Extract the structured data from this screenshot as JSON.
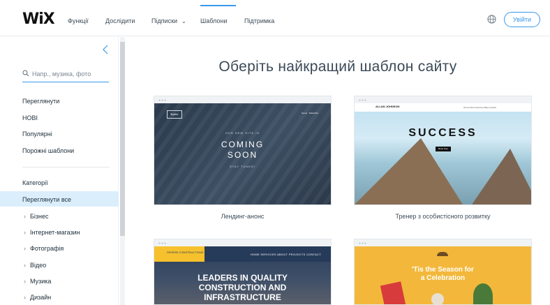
{
  "header": {
    "logo": "WiX",
    "nav": [
      {
        "label": "Функції"
      },
      {
        "label": "Дослідити"
      },
      {
        "label": "Підписки"
      },
      {
        "label": "Шаблони"
      },
      {
        "label": "Підтримка"
      }
    ],
    "active_nav": "Шаблони",
    "login_label": "Увійти"
  },
  "sidebar": {
    "search_placeholder": "Напр., музика, фото",
    "browse": [
      "Переглянути",
      "НОВІ",
      "Популярні",
      "Порожні шаблони"
    ],
    "categories_heading": "Категорії",
    "selected": "Переглянути все",
    "categories": [
      "Бізнес",
      "Інтернет-магазин",
      "Фотографія",
      "Відео",
      "Музика",
      "Дизайн"
    ]
  },
  "main": {
    "title": "Оберіть найкращий шаблон сайту",
    "cards": [
      {
        "name": "Лендинг-анонс",
        "thumb": {
          "small_top": "OUR NEW SITE IS",
          "line1": "COMING",
          "line2": "SOON",
          "small_bottom": "STAY TUNED!"
        }
      },
      {
        "name": "Тренер з особистісного розвитку",
        "thumb": {
          "headline": "SUCCESS"
        }
      },
      {
        "name": "",
        "thumb": {
          "brand": "SPHERE CONSTRUCTIONS",
          "nav": "HOME   SERVICES   ABOUT   PROJECTS   CONTACT",
          "line1": "LEADERS IN QUALITY",
          "line2": "CONSTRUCTION AND",
          "line3": "INFRASTRUCTURE"
        }
      },
      {
        "name": "",
        "thumb": {
          "line1": "'Tis the Season for",
          "line2": "a Celebration"
        }
      }
    ]
  },
  "colors": {
    "accent": "#3899ec",
    "selected_bg": "#dbeefc",
    "heading": "#3b4a57"
  }
}
